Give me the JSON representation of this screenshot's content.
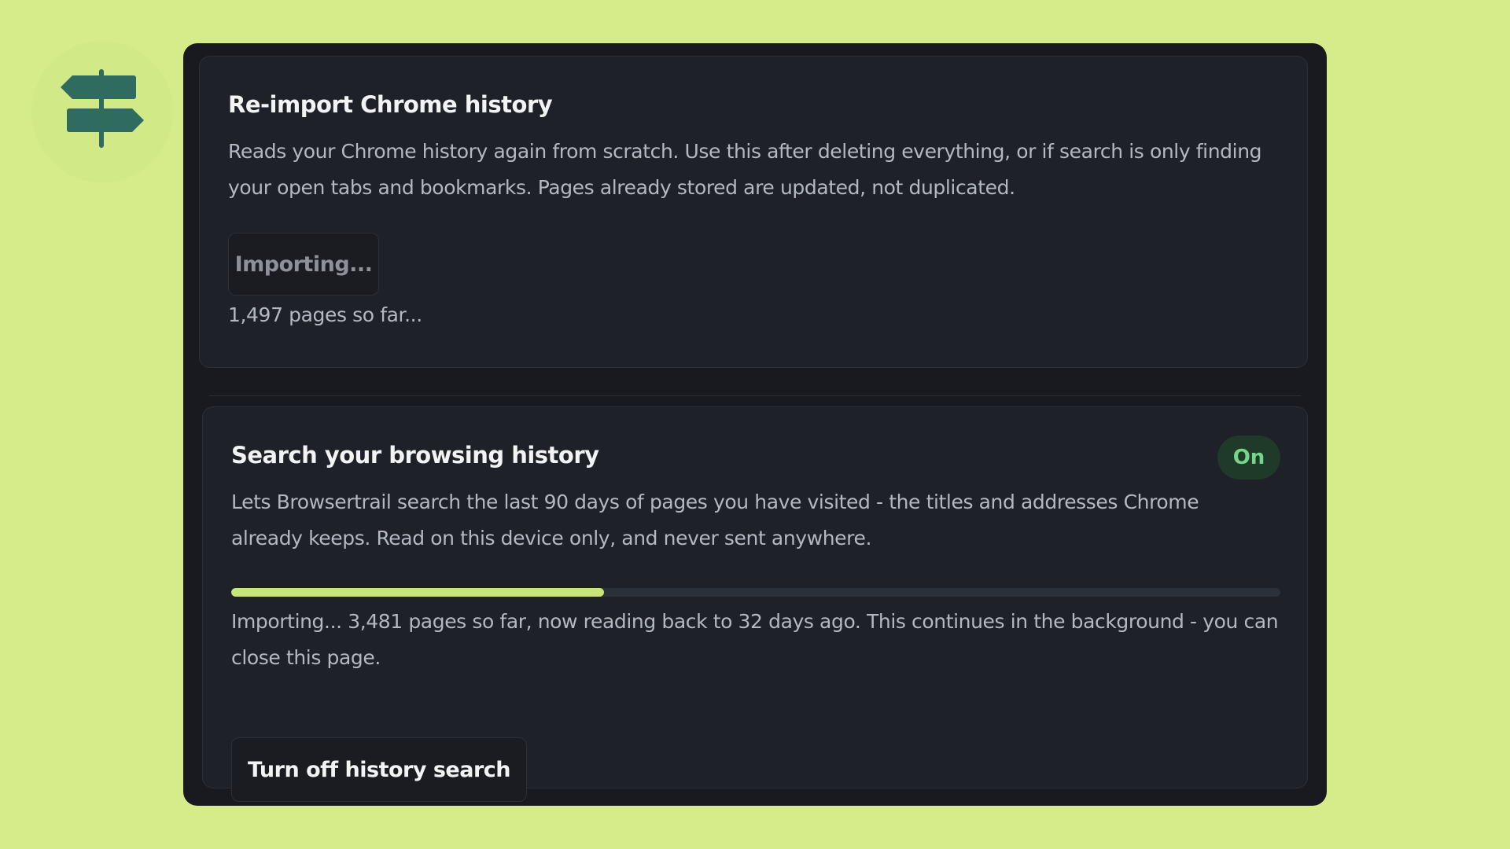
{
  "colors": {
    "page_background": "#d6ec8a",
    "panel_background": "#181a1f",
    "card_background": "#1e2128",
    "logo_sign": "#2f6b5e",
    "accent": "#c8e57a",
    "badge_text": "#74d68a"
  },
  "logo": {
    "icon": "signpost-icon"
  },
  "reimport": {
    "title": "Re-import Chrome history",
    "description": "Reads your Chrome history again from scratch. Use this after deleting everything, or if search is only finding your open tabs and bookmarks. Pages already stored are updated, not duplicated.",
    "button_label": "Importing...",
    "status": "1,497 pages so far..."
  },
  "history_search": {
    "title": "Search your browsing history",
    "badge": "On",
    "description": "Lets Browsertrail search the last 90 days of pages you have visited - the titles and addresses Chrome already keeps. Read on this device only, and never sent anywhere.",
    "progress_percent": 35.5,
    "status": "Importing... 3,481 pages so far, now reading back to 32 days ago. This continues in the background - you can close this page.",
    "button_label": "Turn off history search"
  }
}
